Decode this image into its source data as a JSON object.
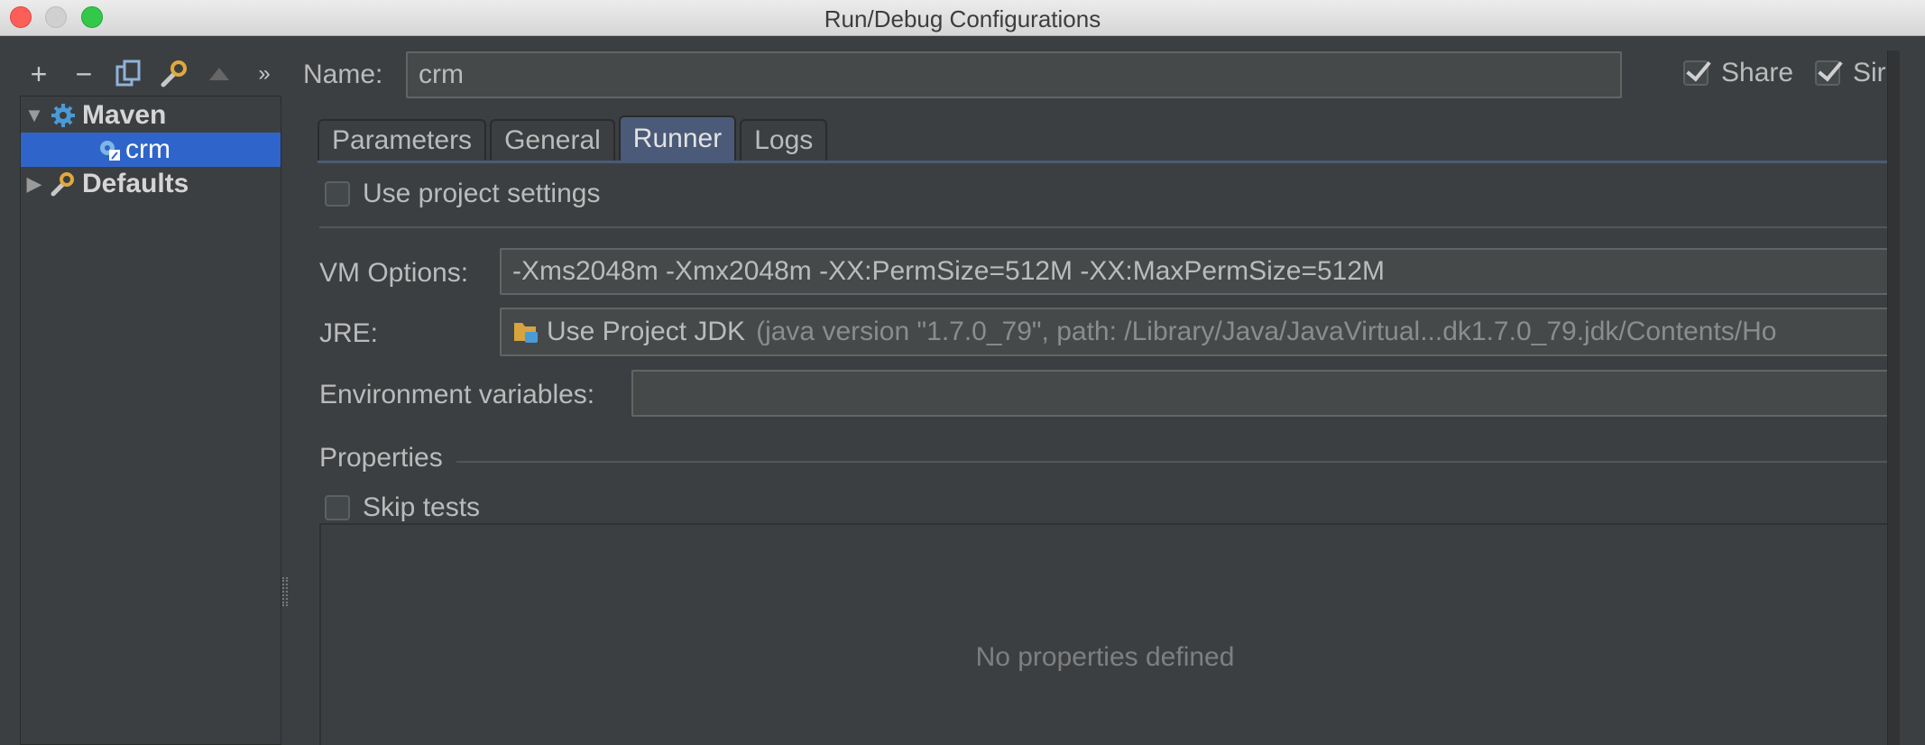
{
  "window": {
    "title": "Run/Debug Configurations"
  },
  "toolbar": {
    "add": "+",
    "remove": "−",
    "more": "»"
  },
  "tree": {
    "maven_label": "Maven",
    "crm_label": "crm",
    "defaults_label": "Defaults"
  },
  "form": {
    "name_label": "Name:",
    "name_value": "crm",
    "share_label": "Share",
    "single_label": "Sir",
    "tabs": [
      "Parameters",
      "General",
      "Runner",
      "Logs"
    ],
    "active_tab": "Runner",
    "use_project_settings": "Use project settings",
    "vm_options_label": "VM Options:",
    "vm_options_value": "-Xms2048m -Xmx2048m -XX:PermSize=512M -XX:MaxPermSize=512M",
    "jre_label": "JRE:",
    "jre_value": "Use Project JDK",
    "jre_detail": "(java version \"1.7.0_79\", path: /Library/Java/JavaVirtual...dk1.7.0_79.jdk/Contents/Ho",
    "env_label": "Environment variables:",
    "env_value": "",
    "properties_label": "Properties",
    "skip_tests": "Skip tests",
    "no_properties": "No properties defined"
  },
  "colors": {
    "background": "#3c3f41",
    "selection": "#2f65ca",
    "active_tab": "#4a5a78"
  }
}
